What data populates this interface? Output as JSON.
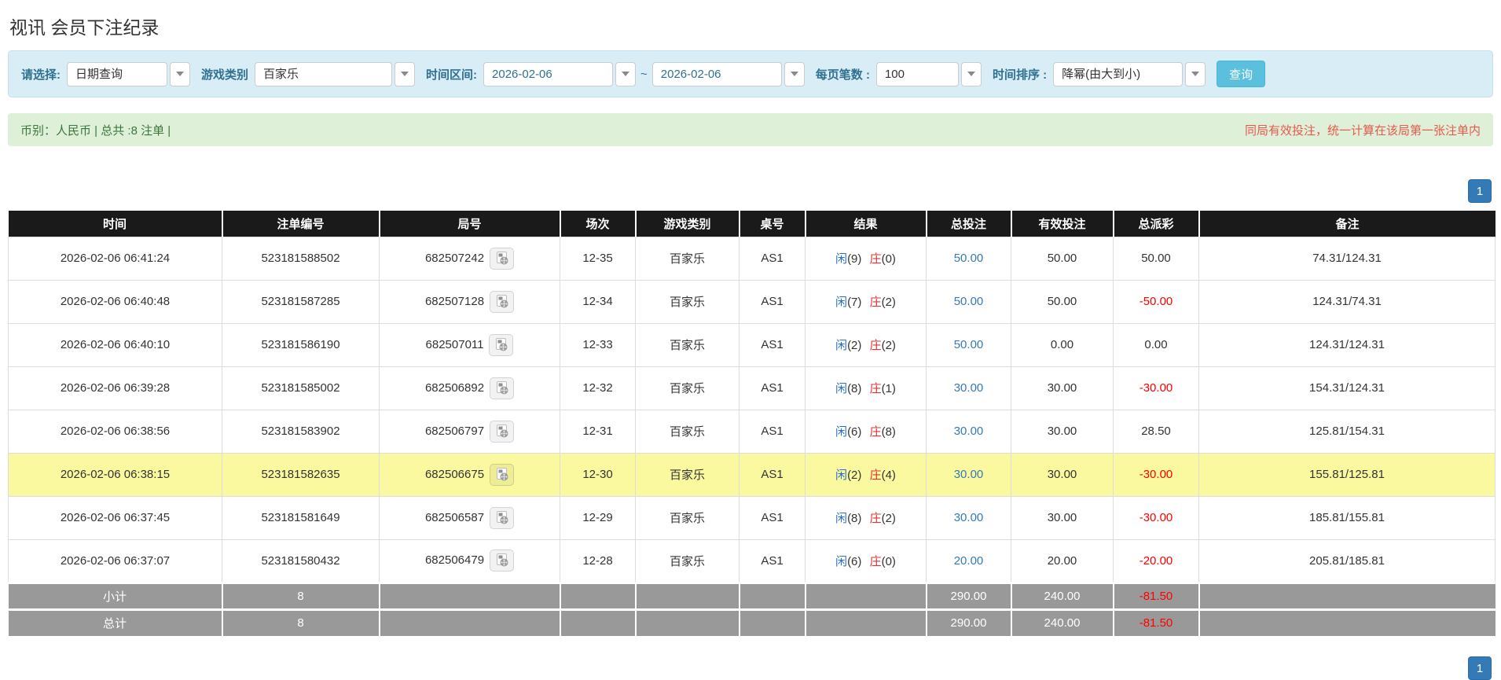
{
  "title": "视讯 会员下注纪录",
  "filters": {
    "type_label": "请选择:",
    "type_value": "日期查询",
    "game_label": "游戏类别",
    "game_value": "百家乐",
    "range_label": "时间区间:",
    "date_from": "2026-02-06",
    "range_separator": "~",
    "date_to": "2026-02-06",
    "page_size_label": "每页笔数 :",
    "page_size_value": "100",
    "sort_label": "时间排序 :",
    "sort_value": "降幂(由大到小)",
    "search_label": "查询"
  },
  "summary": {
    "currency_info": "币别：人民币 | 总共 :8 注单 |",
    "notice": "同局有效投注，统一计算在该局第一张注单内"
  },
  "pagination": {
    "current_page": "1"
  },
  "table": {
    "headers": [
      "时间",
      "注单编号",
      "局号",
      "场次",
      "游戏类别",
      "桌号",
      "结果",
      "总投注",
      "有效投注",
      "总派彩",
      "备注"
    ],
    "rows": [
      {
        "time": "2026-02-06 06:41:24",
        "bet_no": "523181588502",
        "round_no": "682507242",
        "session": "12-35",
        "game": "百家乐",
        "table_no": "AS1",
        "player_label": "闲",
        "player_score": "(9)",
        "banker_label": "庄",
        "banker_score": "(0)",
        "total_bet": "50.00",
        "valid_bet": "50.00",
        "payout": "50.00",
        "remark": "74.31/124.31",
        "highlight": false
      },
      {
        "time": "2026-02-06 06:40:48",
        "bet_no": "523181587285",
        "round_no": "682507128",
        "session": "12-34",
        "game": "百家乐",
        "table_no": "AS1",
        "player_label": "闲",
        "player_score": "(7)",
        "banker_label": "庄",
        "banker_score": "(2)",
        "total_bet": "50.00",
        "valid_bet": "50.00",
        "payout": "-50.00",
        "remark": "124.31/74.31",
        "highlight": false
      },
      {
        "time": "2026-02-06 06:40:10",
        "bet_no": "523181586190",
        "round_no": "682507011",
        "session": "12-33",
        "game": "百家乐",
        "table_no": "AS1",
        "player_label": "闲",
        "player_score": "(2)",
        "banker_label": "庄",
        "banker_score": "(2)",
        "total_bet": "50.00",
        "valid_bet": "0.00",
        "payout": "0.00",
        "remark": "124.31/124.31",
        "highlight": false
      },
      {
        "time": "2026-02-06 06:39:28",
        "bet_no": "523181585002",
        "round_no": "682506892",
        "session": "12-32",
        "game": "百家乐",
        "table_no": "AS1",
        "player_label": "闲",
        "player_score": "(8)",
        "banker_label": "庄",
        "banker_score": "(1)",
        "total_bet": "30.00",
        "valid_bet": "30.00",
        "payout": "-30.00",
        "remark": "154.31/124.31",
        "highlight": false
      },
      {
        "time": "2026-02-06 06:38:56",
        "bet_no": "523181583902",
        "round_no": "682506797",
        "session": "12-31",
        "game": "百家乐",
        "table_no": "AS1",
        "player_label": "闲",
        "player_score": "(6)",
        "banker_label": "庄",
        "banker_score": "(8)",
        "total_bet": "30.00",
        "valid_bet": "30.00",
        "payout": "28.50",
        "remark": "125.81/154.31",
        "highlight": false
      },
      {
        "time": "2026-02-06 06:38:15",
        "bet_no": "523181582635",
        "round_no": "682506675",
        "session": "12-30",
        "game": "百家乐",
        "table_no": "AS1",
        "player_label": "闲",
        "player_score": "(2)",
        "banker_label": "庄",
        "banker_score": "(4)",
        "total_bet": "30.00",
        "valid_bet": "30.00",
        "payout": "-30.00",
        "remark": "155.81/125.81",
        "highlight": true
      },
      {
        "time": "2026-02-06 06:37:45",
        "bet_no": "523181581649",
        "round_no": "682506587",
        "session": "12-29",
        "game": "百家乐",
        "table_no": "AS1",
        "player_label": "闲",
        "player_score": "(8)",
        "banker_label": "庄",
        "banker_score": "(2)",
        "total_bet": "30.00",
        "valid_bet": "30.00",
        "payout": "-30.00",
        "remark": "185.81/155.81",
        "highlight": false
      },
      {
        "time": "2026-02-06 06:37:07",
        "bet_no": "523181580432",
        "round_no": "682506479",
        "session": "12-28",
        "game": "百家乐",
        "table_no": "AS1",
        "player_label": "闲",
        "player_score": "(6)",
        "banker_label": "庄",
        "banker_score": "(0)",
        "total_bet": "20.00",
        "valid_bet": "20.00",
        "payout": "-20.00",
        "remark": "205.81/185.81",
        "highlight": false
      }
    ],
    "subtotal": {
      "label": "小计",
      "count": "8",
      "total_bet": "290.00",
      "valid_bet": "240.00",
      "payout": "-81.50"
    },
    "total": {
      "label": "总计",
      "count": "8",
      "total_bet": "290.00",
      "valid_bet": "240.00",
      "payout": "-81.50"
    }
  },
  "colors": {
    "panel_blue": "#d9edf7",
    "label_blue": "#31708f",
    "button_blue": "#5bc0de",
    "accent_blue": "#337ab7",
    "success_green": "#dff0d8",
    "green_text": "#3c763d",
    "notice_red": "#e9594c",
    "negative_red": "#ff0000",
    "highlight_yellow": "#fbf9a0",
    "header_black": "#1a1a1a",
    "subtotal_gray": "#999999",
    "player_blue": "#2a6fce",
    "banker_red": "#e03333"
  }
}
